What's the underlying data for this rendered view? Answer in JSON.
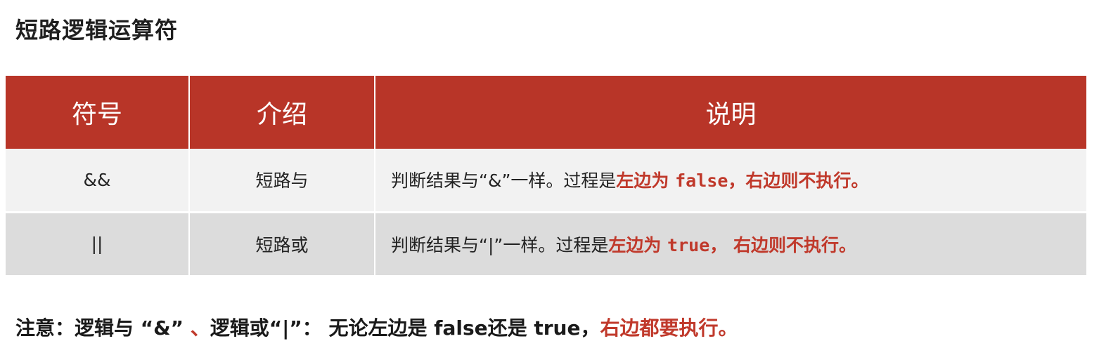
{
  "title": "短路逻辑运算符",
  "table": {
    "headers": [
      "符号",
      "介绍",
      "说明"
    ],
    "rows": [
      {
        "symbol": "&&",
        "name": "短路与",
        "desc_prefix": "判断结果与“&”一样。过程是",
        "desc_red1": "左边为 ",
        "desc_code": "false，",
        "desc_red2": "右边则不执行。"
      },
      {
        "symbol": "||",
        "name": "短路或",
        "desc_prefix": "判断结果与“|”一样。过程是",
        "desc_red1": "左边为 ",
        "desc_code": "true，",
        "desc_red2": " 右边则不执行。"
      }
    ]
  },
  "note": {
    "part1": "注意：逻辑与 “&” ",
    "separator": "、",
    "part2": "逻辑或“|”： 无论左边是 false还是 true，",
    "emphasis": "右边都要执行。"
  },
  "colors": {
    "header_bg": "#b83528",
    "accent_red": "#c0392b",
    "row1_bg": "#f2f2f2",
    "row2_bg": "#dcdcdc"
  }
}
